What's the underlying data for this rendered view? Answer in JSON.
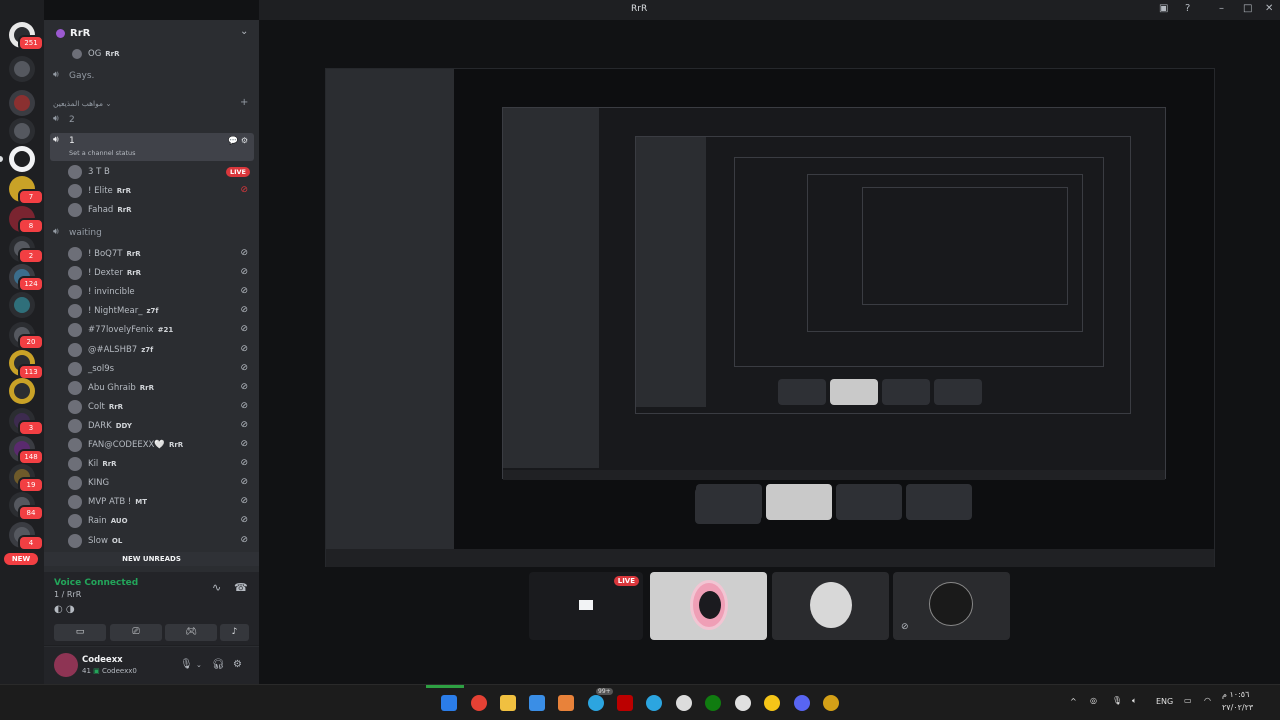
{
  "window": {
    "title": "RrR"
  },
  "rail": {
    "servers": [
      {
        "badge": "251"
      },
      {
        "badge": ""
      },
      {
        "badge": ""
      },
      {
        "badge": ""
      },
      {
        "badge": ""
      },
      {
        "badge": "7"
      },
      {
        "badge": "8"
      },
      {
        "badge": "2"
      },
      {
        "badge": "124"
      },
      {
        "badge": ""
      },
      {
        "badge": "20"
      },
      {
        "badge": "113"
      },
      {
        "badge": ""
      },
      {
        "badge": "3"
      },
      {
        "badge": "148"
      },
      {
        "badge": "19"
      },
      {
        "badge": "84"
      },
      {
        "badge": "4"
      }
    ],
    "new_label": "NEW"
  },
  "sidebar": {
    "server_name": "RrR",
    "top_member": {
      "name": "OG",
      "tag": "RrR"
    },
    "channels": {
      "gays": "Gays.",
      "category": "مواهب المذيعين",
      "ch2": "2",
      "ch1": "1",
      "ch1_status": "Set a channel status",
      "waiting": "waiting"
    },
    "ch1_members": [
      {
        "name": "3 T B",
        "tag": "",
        "live": "LIVE"
      },
      {
        "name": "! Elite",
        "tag": "RrR"
      },
      {
        "name": "Fahad",
        "tag": "RrR"
      }
    ],
    "waiting_members": [
      {
        "name": "! BoQ7T",
        "tag": "RrR"
      },
      {
        "name": "! Dexter",
        "tag": "RrR"
      },
      {
        "name": "! invincible",
        "tag": ""
      },
      {
        "name": "! NightMear_",
        "tag": "z7f"
      },
      {
        "name": "#77lovelyFenix",
        "tag": "#21"
      },
      {
        "name": "@#ALSHB7",
        "tag": "z7f"
      },
      {
        "name": "_sol9s",
        "tag": ""
      },
      {
        "name": "Abu Ghraib",
        "tag": "RrR"
      },
      {
        "name": "Colt",
        "tag": "RrR"
      },
      {
        "name": "DARK",
        "tag": "DDY"
      },
      {
        "name": "FAN@CODEEXX🤍",
        "tag": "RrR"
      },
      {
        "name": "Kil",
        "tag": "RrR"
      },
      {
        "name": "KING",
        "tag": ""
      },
      {
        "name": "MVP ATB !",
        "tag": "MT"
      },
      {
        "name": "Rain",
        "tag": "AUO"
      },
      {
        "name": "Slow",
        "tag": "OL"
      }
    ],
    "new_unreads": "NEW UNREADS",
    "voice": {
      "status": "Voice Connected",
      "channel": "1 / RrR"
    },
    "user": {
      "name": "Codeexx",
      "status": "Codeexx0",
      "status_prefix": "41"
    }
  },
  "stream": {
    "tiles": [
      {
        "live": "LIVE"
      },
      {},
      {},
      {}
    ]
  },
  "taskbar": {
    "lang": "ENG",
    "time": "١٠:٥٦ م",
    "date": "٢٧/٠٢/٢٣",
    "badge": "99+"
  }
}
